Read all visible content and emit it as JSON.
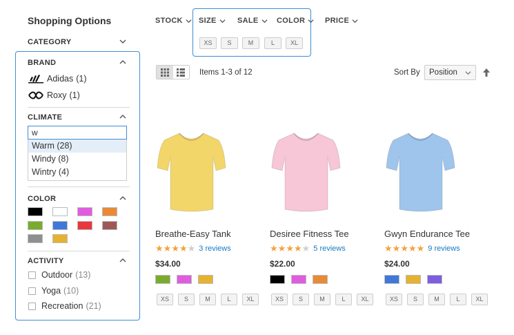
{
  "sidebar": {
    "title": "Shopping Options",
    "category": {
      "label": "CATEGORY"
    },
    "brand": {
      "label": "BRAND",
      "items": [
        {
          "name": "Adidas",
          "count": "(1)",
          "logo": "adidas-logo"
        },
        {
          "name": "Roxy",
          "count": "(1)",
          "logo": "roxy-logo"
        }
      ]
    },
    "climate": {
      "label": "CLIMATE",
      "search_value": "w",
      "options": [
        {
          "label": "Warm (28)",
          "highlighted": true
        },
        {
          "label": "Windy (8)",
          "highlighted": false
        },
        {
          "label": "Wintry (4)",
          "highlighted": false
        }
      ]
    },
    "color": {
      "label": "COLOR",
      "swatches": [
        "#000000",
        "#ffffff",
        "#e05ce0",
        "#ea8a35",
        "#7bab2e",
        "#3f78d8",
        "#e8383d",
        "#9e5858",
        "#8f8f8f",
        "#e6b22f"
      ]
    },
    "activity": {
      "label": "ACTIVITY",
      "items": [
        {
          "name": "Outdoor",
          "count": "(13)"
        },
        {
          "name": "Yoga",
          "count": "(10)"
        },
        {
          "name": "Recreation",
          "count": "(21)"
        }
      ]
    }
  },
  "filterbar": {
    "stock": "STOCK",
    "size": "SIZE",
    "sale": "SALE",
    "color": "COLOR",
    "price": "PRICE",
    "size_options": [
      "XS",
      "S",
      "M",
      "L",
      "XL"
    ]
  },
  "toolbar": {
    "items_count": "Items 1-3 of 12",
    "sort_label": "Sort By",
    "sort_value": "Position"
  },
  "products": [
    {
      "name": "Breathe-Easy Tank",
      "rating": 4,
      "reviews": "3 reviews",
      "price": "$34.00",
      "shirt_color": "#f3d66a",
      "colors": [
        "#7bab2e",
        "#e05ce0",
        "#e6b22f"
      ],
      "sizes": [
        "XS",
        "S",
        "M",
        "L",
        "XL"
      ]
    },
    {
      "name": "Desiree Fitness Tee",
      "rating": 4,
      "reviews": "5 reviews",
      "price": "$22.00",
      "shirt_color": "#f7c6d7",
      "colors": [
        "#000000",
        "#e05ce0",
        "#ea8a35"
      ],
      "sizes": [
        "XS",
        "S",
        "M",
        "L",
        "XL"
      ]
    },
    {
      "name": "Gwyn Endurance Tee",
      "rating": 5,
      "reviews": "9 reviews",
      "price": "$24.00",
      "shirt_color": "#9fc5ec",
      "colors": [
        "#3f78d8",
        "#e6b22f",
        "#7b5fe0"
      ],
      "sizes": [
        "XS",
        "S",
        "M",
        "L",
        "XL"
      ]
    }
  ]
}
